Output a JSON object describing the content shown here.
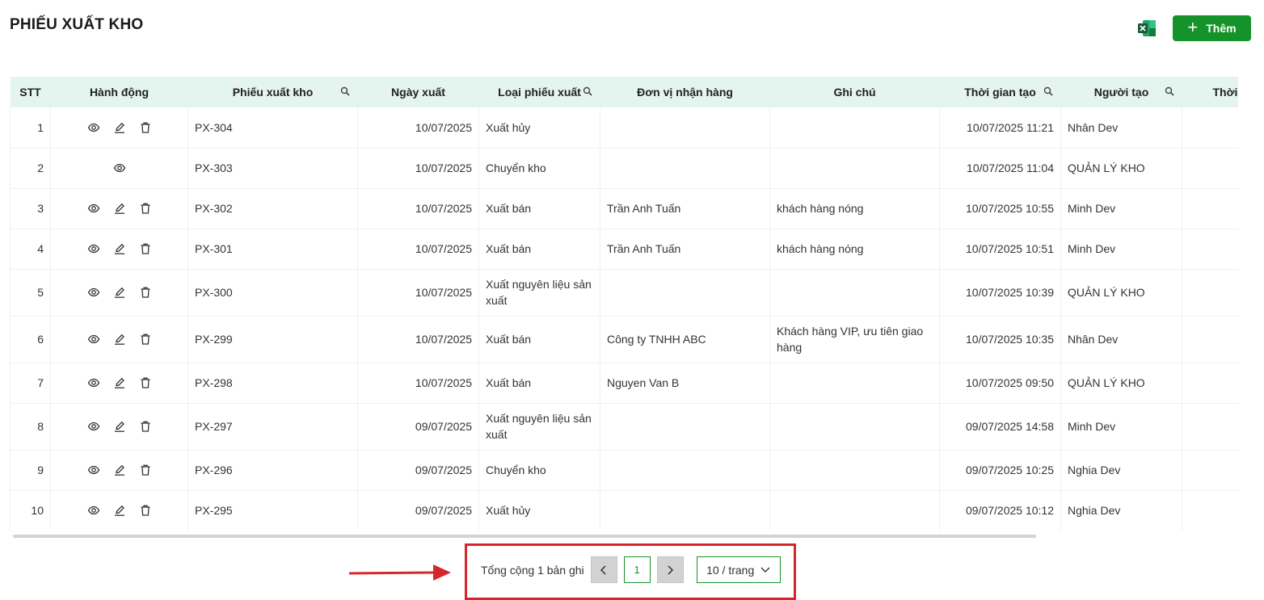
{
  "page": {
    "title": "PHIẾU XUẤT KHO"
  },
  "toolbar": {
    "add_label": "Thêm",
    "excel_icon": "excel-export-icon",
    "accent": "#15932a"
  },
  "table": {
    "columns": [
      "STT",
      "Hành động",
      "Phiếu xuất kho",
      "Ngày xuất",
      "Loại phiếu xuất",
      "Đơn vị nhận hàng",
      "Ghi chú",
      "Thời gian tạo",
      "Người tạo",
      "Thời gia"
    ],
    "rows": [
      {
        "stt": "1",
        "code": "PX-304",
        "date": "10/07/2025",
        "type": "Xuất hủy",
        "receiver": "",
        "note": "",
        "created": "10/07/2025 11:21",
        "creator": "Nhân Dev",
        "actions": [
          "view",
          "edit",
          "delete"
        ]
      },
      {
        "stt": "2",
        "code": "PX-303",
        "date": "10/07/2025",
        "type": "Chuyển kho",
        "receiver": "",
        "note": "",
        "created": "10/07/2025 11:04",
        "creator": "QUẢN LÝ KHO",
        "actions": [
          "view"
        ]
      },
      {
        "stt": "3",
        "code": "PX-302",
        "date": "10/07/2025",
        "type": "Xuất bán",
        "receiver": "Trần Anh Tuấn",
        "note": "khách hàng nóng",
        "created": "10/07/2025 10:55",
        "creator": "Minh Dev",
        "actions": [
          "view",
          "edit",
          "delete"
        ]
      },
      {
        "stt": "4",
        "code": "PX-301",
        "date": "10/07/2025",
        "type": "Xuất bán",
        "receiver": "Trần Anh Tuấn",
        "note": "khách hàng nóng",
        "created": "10/07/2025 10:51",
        "creator": "Minh Dev",
        "actions": [
          "view",
          "edit",
          "delete"
        ]
      },
      {
        "stt": "5",
        "code": "PX-300",
        "date": "10/07/2025",
        "type": "Xuất nguyên liệu sản xuất",
        "receiver": "",
        "note": "",
        "created": "10/07/2025 10:39",
        "creator": "QUẢN LÝ KHO",
        "actions": [
          "view",
          "edit",
          "delete"
        ]
      },
      {
        "stt": "6",
        "code": "PX-299",
        "date": "10/07/2025",
        "type": "Xuất bán",
        "receiver": "Công ty TNHH ABC",
        "note": "Khách hàng VIP, ưu tiên giao hàng",
        "created": "10/07/2025 10:35",
        "creator": "Nhân Dev",
        "actions": [
          "view",
          "edit",
          "delete"
        ]
      },
      {
        "stt": "7",
        "code": "PX-298",
        "date": "10/07/2025",
        "type": "Xuất bán",
        "receiver": "Nguyen Van B",
        "note": "",
        "created": "10/07/2025 09:50",
        "creator": "QUẢN LÝ KHO",
        "actions": [
          "view",
          "edit",
          "delete"
        ]
      },
      {
        "stt": "8",
        "code": "PX-297",
        "date": "09/07/2025",
        "type": "Xuất nguyên liệu sản xuất",
        "receiver": "",
        "note": "",
        "created": "09/07/2025 14:58",
        "creator": "Minh Dev",
        "actions": [
          "view",
          "edit",
          "delete"
        ]
      },
      {
        "stt": "9",
        "code": "PX-296",
        "date": "09/07/2025",
        "type": "Chuyển kho",
        "receiver": "",
        "note": "",
        "created": "09/07/2025 10:25",
        "creator": "Nghia Dev",
        "actions": [
          "view",
          "edit",
          "delete"
        ]
      },
      {
        "stt": "10",
        "code": "PX-295",
        "date": "09/07/2025",
        "type": "Xuất hủy",
        "receiver": "",
        "note": "",
        "created": "09/07/2025 10:12",
        "creator": "Nghia Dev",
        "actions": [
          "view",
          "edit",
          "delete"
        ]
      }
    ]
  },
  "pagination": {
    "total_text": "Tổng cộng 1 bản ghi",
    "current_page": "1",
    "page_size": "10 / trang",
    "prev": "<",
    "next": ">",
    "highlight_color": "#d7262a"
  }
}
